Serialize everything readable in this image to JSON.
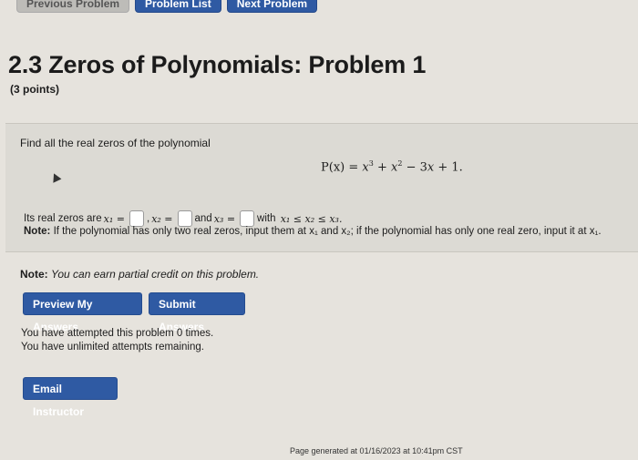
{
  "nav": {
    "previous": "Previous Problem",
    "list": "Problem List",
    "next": "Next Problem"
  },
  "title": "2.3 Zeros of Polynomials: Problem 1",
  "points": "(3 points)",
  "problem": {
    "prompt": "Find all the real zeros of the polynomial",
    "equation_lhs": "P(x) = ",
    "zeros_prefix": "Its real zeros are",
    "x1": "x₁ =",
    "x2": "x₂ =",
    "and": "and",
    "x3": "x₃ =",
    "with": "with",
    "order": "x₁ ≤ x₂ ≤ x₃.",
    "note_label": "Note:",
    "note_text": " If the polynomial has only two real zeros, input them at x₁ and x₂; if the polynomial has only one real zero, input it at x₁."
  },
  "partial_label": "Note:",
  "partial_text": "You can earn partial credit on this problem.",
  "buttons": {
    "preview": "Preview My Answers",
    "submit": "Submit Answers",
    "email": "Email Instructor"
  },
  "attempts": {
    "line1": "You have attempted this problem 0 times.",
    "line2": "You have unlimited attempts remaining."
  },
  "footer": "Page generated at 01/16/2023 at 10:41pm CST",
  "colors": {
    "accent": "#2f5aa3",
    "background": "#e6e3dd"
  }
}
